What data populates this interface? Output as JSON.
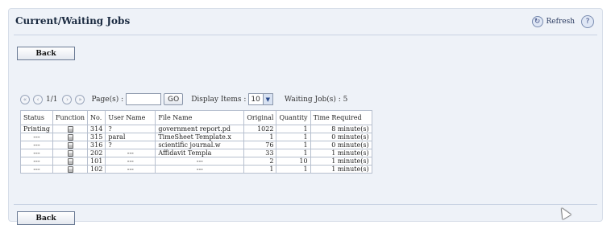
{
  "panel": {
    "title": "Current/Waiting Jobs",
    "refresh_label": "Refresh",
    "back_label": "Back"
  },
  "toolbar": {
    "page_indicator": "1/1",
    "page_label": "Page(s) :",
    "page_value": "",
    "go_label": "GO",
    "display_label": "Display Items :",
    "display_value": "10",
    "waiting_label": "Waiting Job(s) : 5"
  },
  "table": {
    "headers": [
      "Status",
      "Function",
      "No.",
      "User Name",
      "File Name",
      "Original",
      "Quantity",
      "Time Required"
    ],
    "rows": [
      {
        "status": "Printing",
        "function_icon": "printer-icon",
        "no": "314",
        "user": "?",
        "file": "government report.pd",
        "original": "1022",
        "quantity": "1",
        "time": "8 minute(s)"
      },
      {
        "status": "---",
        "function_icon": "printer-icon",
        "no": "315",
        "user": "paral",
        "file": "TimeSheet Template.x",
        "original": "1",
        "quantity": "1",
        "time": "0 minute(s)"
      },
      {
        "status": "---",
        "function_icon": "printer-icon",
        "no": "316",
        "user": "?",
        "file": "scientific journal.w",
        "original": "76",
        "quantity": "1",
        "time": "0 minute(s)"
      },
      {
        "status": "---",
        "function_icon": "copier-icon",
        "no": "202",
        "user": "---",
        "file": "Affidavit Templa",
        "original": "33",
        "quantity": "1",
        "time": "1 minute(s)"
      },
      {
        "status": "---",
        "function_icon": "copier-icon",
        "no": "101",
        "user": "---",
        "file": "---",
        "original": "2",
        "quantity": "10",
        "time": "1 minute(s)"
      },
      {
        "status": "---",
        "function_icon": "copier-icon",
        "no": "102",
        "user": "---",
        "file": "---",
        "original": "1",
        "quantity": "1",
        "time": "1 minute(s)"
      }
    ]
  }
}
